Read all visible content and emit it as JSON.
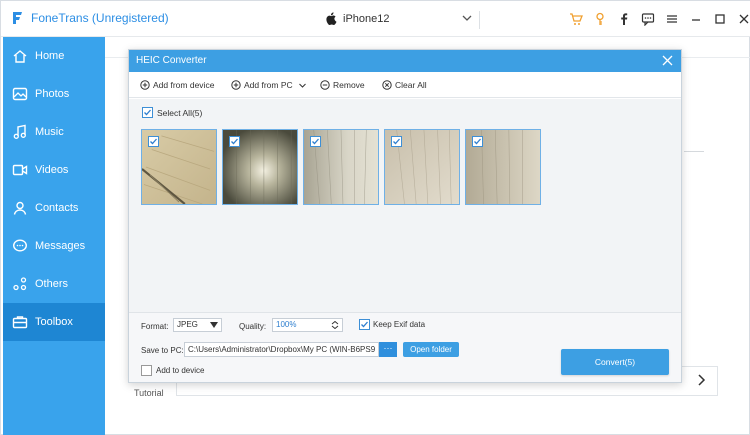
{
  "app": {
    "title": "FoneTrans (Unregistered)",
    "device": "iPhone12",
    "accent": "#39a3ec",
    "toolbar_icons": [
      "cart-icon",
      "key-icon",
      "facebook-icon",
      "chat-icon",
      "menu-icon",
      "minimize-icon",
      "maximize-icon",
      "close-icon"
    ]
  },
  "sidebar": {
    "items": [
      {
        "label": "Home",
        "icon": "home-icon"
      },
      {
        "label": "Photos",
        "icon": "photos-icon"
      },
      {
        "label": "Music",
        "icon": "music-icon"
      },
      {
        "label": "Videos",
        "icon": "videos-icon"
      },
      {
        "label": "Contacts",
        "icon": "contacts-icon"
      },
      {
        "label": "Messages",
        "icon": "messages-icon"
      },
      {
        "label": "Others",
        "icon": "others-icon"
      },
      {
        "label": "Toolbox",
        "icon": "toolbox-icon",
        "active": true
      }
    ]
  },
  "main": {
    "tutorial_label": "Tutorial"
  },
  "dialog": {
    "title": "HEIC Converter",
    "toolbar": {
      "add_from_device": "Add from device",
      "add_from_pc": "Add from PC",
      "remove": "Remove",
      "clear_all": "Clear All"
    },
    "select_all": "Select All(5)",
    "select_all_checked": true,
    "images_checked": [
      true,
      true,
      true,
      true,
      true
    ],
    "footer": {
      "format_label": "Format:",
      "format_value": "JPEG",
      "quality_label": "Quality:",
      "quality_value": "100%",
      "keep_exif_label": "Keep Exif data",
      "keep_exif_checked": true,
      "save_to_label": "Save to PC:",
      "save_path": "C:\\Users\\Administrator\\Dropbox\\My PC (WIN-B6PS9",
      "browse_label": "···",
      "open_folder": "Open folder",
      "add_to_device": "Add to device",
      "add_to_device_checked": false,
      "convert_label": "Convert(5)"
    }
  }
}
